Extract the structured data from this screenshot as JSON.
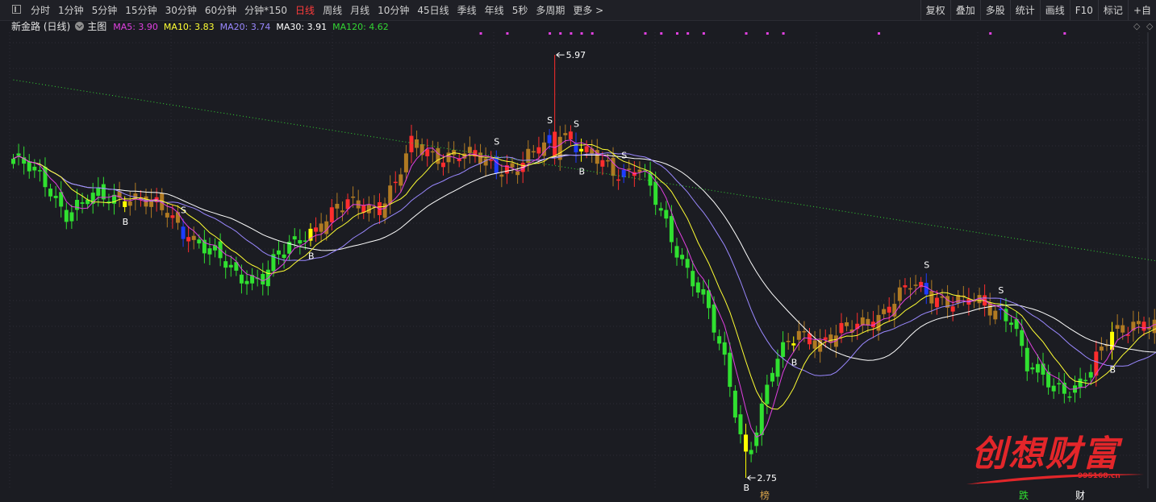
{
  "toolbar": {
    "periods": [
      "分时",
      "1分钟",
      "5分钟",
      "15分钟",
      "30分钟",
      "60分钟",
      "分钟*150",
      "日线",
      "周线",
      "月线",
      "10分钟",
      "45日线",
      "季线",
      "年线",
      "5秒",
      "多周期",
      "更多 >"
    ],
    "active_period": "日线",
    "right_tools": [
      "复权",
      "叠加",
      "多股",
      "统计",
      "画线",
      "F10",
      "标记",
      "+自"
    ]
  },
  "info": {
    "stock_name": "新金路 (日线)",
    "main_label": "主图",
    "ma": [
      {
        "label": "MA5: 3.90",
        "color": "#e040e0"
      },
      {
        "label": "MA10: 3.83",
        "color": "#ffff33"
      },
      {
        "label": "MA20: 3.74",
        "color": "#9a88ff"
      },
      {
        "label": "MA30: 3.91",
        "color": "#ffffff"
      },
      {
        "label": "MA120: 4.62",
        "color": "#33d633"
      }
    ],
    "corner_icons": [
      "diamond-icon",
      "chevron-icon"
    ]
  },
  "chart_data": {
    "type": "candlestick",
    "ylim": [
      2.6,
      6.25
    ],
    "grid": true,
    "colors": {
      "up": "#ff2d2d",
      "down": "#30e030",
      "neutral": "#b07a22",
      "buy": "#ffff00",
      "sell": "#1e3cff",
      "signal_dot": "#e040e0"
    },
    "max_label": "5.97",
    "min_label": "2.75",
    "max_price": 5.97,
    "min_price": 2.75,
    "signal_marks": [
      "B",
      "S"
    ],
    "bottom_labels": [
      {
        "text": "榜",
        "color": "#d6a24a"
      },
      {
        "text": "跌",
        "color": "#30e030"
      },
      {
        "text": "财",
        "color": "#ffffff"
      }
    ],
    "key_prices": [
      [
        0,
        5.18
      ],
      [
        6,
        5.0
      ],
      [
        10,
        4.78
      ],
      [
        16,
        4.88
      ],
      [
        22,
        4.9
      ],
      [
        29,
        4.76
      ],
      [
        36,
        4.5
      ],
      [
        42,
        4.3
      ],
      [
        47,
        4.28
      ],
      [
        50,
        4.42
      ],
      [
        55,
        4.62
      ],
      [
        63,
        4.82
      ],
      [
        69,
        4.83
      ],
      [
        72,
        4.98
      ],
      [
        75,
        5.27
      ],
      [
        82,
        5.2
      ],
      [
        88,
        5.17
      ],
      [
        95,
        5.1
      ],
      [
        100,
        5.27
      ],
      [
        103,
        5.42
      ],
      [
        108,
        5.2
      ],
      [
        113,
        5.08
      ],
      [
        118,
        5.13
      ],
      [
        124,
        4.55
      ],
      [
        130,
        4.15
      ],
      [
        134,
        3.6
      ],
      [
        138,
        2.9
      ],
      [
        141,
        3.3
      ],
      [
        143,
        3.58
      ],
      [
        146,
        3.75
      ],
      [
        148,
        3.85
      ],
      [
        152,
        3.8
      ],
      [
        158,
        3.87
      ],
      [
        163,
        4.0
      ],
      [
        169,
        4.2
      ],
      [
        175,
        4.12
      ],
      [
        180,
        4.08
      ],
      [
        183,
        4.05
      ],
      [
        188,
        4.0
      ],
      [
        191,
        3.58
      ],
      [
        196,
        3.45
      ],
      [
        200,
        3.45
      ],
      [
        203,
        3.55
      ],
      [
        207,
        3.85
      ],
      [
        211,
        3.95
      ],
      [
        215,
        3.88
      ]
    ],
    "buy_days": [
      21,
      56,
      107,
      138,
      147,
      207
    ],
    "sell_days": [
      32,
      91,
      101,
      106,
      115,
      172,
      186
    ],
    "dot_days": [
      88,
      93,
      101,
      103,
      105,
      107,
      109,
      119,
      122,
      125,
      127,
      130,
      138,
      142,
      145,
      163,
      184,
      198
    ]
  },
  "watermark": {
    "text": "创想财富",
    "url": "995168.cn"
  }
}
